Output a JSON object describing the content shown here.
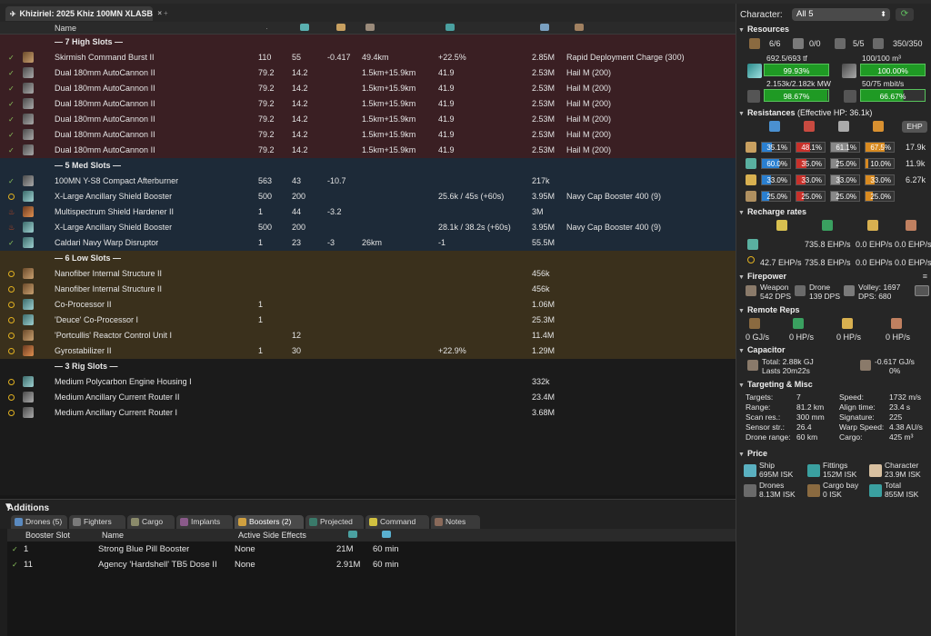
{
  "tab": {
    "title": "Khiziriel: 2025 Khiz 100MN XLASB",
    "close": "×",
    "extra": "+"
  },
  "headers": {
    "name": "Name"
  },
  "rows": [
    {
      "type": "sec",
      "cls": "high",
      "name": "— 7 High Slots —"
    },
    {
      "cls": "high",
      "st": "on",
      "ic": "a",
      "name": "Skirmish Command Burst II",
      "c1": "110",
      "c2": "55",
      "c3": "-0.417",
      "c4": "49.4km",
      "c5": "+22.5%",
      "c6": "2.85M",
      "c7": "Rapid Deployment Charge (300)"
    },
    {
      "cls": "high",
      "st": "on",
      "ic": "c2",
      "name": "Dual 180mm AutoCannon II",
      "c1": "79.2",
      "c2": "14.2",
      "c3": "",
      "c4": "1.5km+15.9km",
      "c5": "41.9",
      "c6": "2.53M",
      "c7": "Hail M (200)"
    },
    {
      "cls": "high",
      "st": "on",
      "ic": "c2",
      "name": "Dual 180mm AutoCannon II",
      "c1": "79.2",
      "c2": "14.2",
      "c3": "",
      "c4": "1.5km+15.9km",
      "c5": "41.9",
      "c6": "2.53M",
      "c7": "Hail M (200)"
    },
    {
      "cls": "high",
      "st": "on",
      "ic": "c2",
      "name": "Dual 180mm AutoCannon II",
      "c1": "79.2",
      "c2": "14.2",
      "c3": "",
      "c4": "1.5km+15.9km",
      "c5": "41.9",
      "c6": "2.53M",
      "c7": "Hail M (200)"
    },
    {
      "cls": "high",
      "st": "on",
      "ic": "c2",
      "name": "Dual 180mm AutoCannon II",
      "c1": "79.2",
      "c2": "14.2",
      "c3": "",
      "c4": "1.5km+15.9km",
      "c5": "41.9",
      "c6": "2.53M",
      "c7": "Hail M (200)"
    },
    {
      "cls": "high",
      "st": "on",
      "ic": "c2",
      "name": "Dual 180mm AutoCannon II",
      "c1": "79.2",
      "c2": "14.2",
      "c3": "",
      "c4": "1.5km+15.9km",
      "c5": "41.9",
      "c6": "2.53M",
      "c7": "Hail M (200)"
    },
    {
      "cls": "high",
      "st": "on",
      "ic": "c2",
      "name": "Dual 180mm AutoCannon II",
      "c1": "79.2",
      "c2": "14.2",
      "c3": "",
      "c4": "1.5km+15.9km",
      "c5": "41.9",
      "c6": "2.53M",
      "c7": "Hail M (200)"
    },
    {
      "type": "sec",
      "cls": "med",
      "name": "— 5 Med Slots —"
    },
    {
      "cls": "med",
      "st": "on",
      "ic": "c2",
      "name": "100MN Y-S8 Compact Afterburner",
      "c1": "563",
      "c2": "43",
      "c3": "-10.7",
      "c4": "",
      "c5": "",
      "c6": "217k",
      "c7": ""
    },
    {
      "cls": "med",
      "st": "off",
      "ic": "b",
      "name": "X-Large Ancillary Shield Booster",
      "c1": "500",
      "c2": "200",
      "c3": "",
      "c4": "",
      "c5": "25.6k / 45s (+60s)",
      "c6": "3.95M",
      "c7": "Navy Cap Booster 400 (9)"
    },
    {
      "cls": "med",
      "st": "ovr",
      "ic": "e",
      "name": "Multispectrum Shield Hardener II",
      "c1": "1",
      "c2": "44",
      "c3": "-3.2",
      "c4": "",
      "c5": "",
      "c6": "3M",
      "c7": ""
    },
    {
      "cls": "med",
      "st": "ovr",
      "ic": "b",
      "name": "X-Large Ancillary Shield Booster",
      "c1": "500",
      "c2": "200",
      "c3": "",
      "c4": "",
      "c5": "28.1k / 38.2s (+60s)",
      "c6": "3.95M",
      "c7": "Navy Cap Booster 400 (9)"
    },
    {
      "cls": "med",
      "st": "on",
      "ic": "b",
      "name": "Caldari Navy Warp Disruptor",
      "c1": "1",
      "c2": "23",
      "c3": "-3",
      "c4": "26km",
      "c5": "-1",
      "c6": "55.5M",
      "c7": ""
    },
    {
      "type": "sec",
      "cls": "low",
      "name": "— 6 Low Slots —"
    },
    {
      "cls": "low",
      "st": "off",
      "ic": "a",
      "name": "Nanofiber Internal Structure II",
      "c1": "",
      "c2": "",
      "c3": "",
      "c4": "",
      "c5": "",
      "c6": "456k",
      "c7": ""
    },
    {
      "cls": "low",
      "st": "off",
      "ic": "a",
      "name": "Nanofiber Internal Structure II",
      "c1": "",
      "c2": "",
      "c3": "",
      "c4": "",
      "c5": "",
      "c6": "456k",
      "c7": ""
    },
    {
      "cls": "low",
      "st": "off",
      "ic": "b",
      "name": "Co-Processor II",
      "c1": "1",
      "c2": "",
      "c3": "",
      "c4": "",
      "c5": "",
      "c6": "1.06M",
      "c7": ""
    },
    {
      "cls": "low",
      "st": "off",
      "ic": "b",
      "name": "'Deuce' Co-Processor I",
      "c1": "1",
      "c2": "",
      "c3": "",
      "c4": "",
      "c5": "",
      "c6": "25.3M",
      "c7": ""
    },
    {
      "cls": "low",
      "st": "off",
      "ic": "a",
      "name": "'Portcullis' Reactor Control Unit I",
      "c1": "",
      "c2": "12",
      "c3": "",
      "c4": "",
      "c5": "",
      "c6": "11.4M",
      "c7": ""
    },
    {
      "cls": "low",
      "st": "off",
      "ic": "e",
      "name": "Gyrostabilizer II",
      "c1": "1",
      "c2": "30",
      "c3": "",
      "c4": "",
      "c5": "+22.9%",
      "c6": "1.29M",
      "c7": ""
    },
    {
      "type": "sec",
      "cls": "rig",
      "name": "— 3 Rig Slots —"
    },
    {
      "cls": "rig",
      "st": "off",
      "ic": "b",
      "name": "Medium Polycarbon Engine Housing I",
      "c1": "",
      "c2": "",
      "c3": "",
      "c4": "",
      "c5": "",
      "c6": "332k",
      "c7": ""
    },
    {
      "cls": "rig",
      "st": "off",
      "ic": "c2",
      "name": "Medium Ancillary Current Router II",
      "c1": "",
      "c2": "",
      "c3": "",
      "c4": "",
      "c5": "",
      "c6": "23.4M",
      "c7": ""
    },
    {
      "cls": "rig",
      "st": "off",
      "ic": "c2",
      "name": "Medium Ancillary Current Router I",
      "c1": "",
      "c2": "",
      "c3": "",
      "c4": "",
      "c5": "",
      "c6": "3.68M",
      "c7": ""
    }
  ],
  "additions": {
    "title": "Additions",
    "tabs": [
      "Drones (5)",
      "Fighters",
      "Cargo",
      "Implants",
      "Boosters (2)",
      "Projected",
      "Command",
      "Notes"
    ],
    "selected_tab": "Boosters (2)",
    "headers": {
      "slot": "Booster Slot",
      "name": "Name",
      "effects": "Active Side Effects"
    },
    "rows": [
      {
        "slot": "1",
        "name": "Strong Blue Pill Booster",
        "effects": "None",
        "price": "21M",
        "dur": "60 min"
      },
      {
        "slot": "11",
        "name": "Agency 'Hardshell' TB5 Dose II",
        "effects": "None",
        "price": "2.91M",
        "dur": "60 min"
      }
    ]
  },
  "right": {
    "character_label": "Character:",
    "character_value": "All 5",
    "resources": {
      "title": "Resources",
      "hardpoints": [
        "6/6",
        "0/0",
        "5/5",
        "350/350"
      ],
      "cpu_text": "692.5/693 tf",
      "cpu_pct": "99.93%",
      "cpu_frac": 0.9993,
      "drone_bay": "100/100 m³",
      "drone_pct": "100.00%",
      "drone_frac": 1.0,
      "pg_text": "2.153k/2.182k MW",
      "pg_pct": "98.67%",
      "pg_frac": 0.9867,
      "bw_text": "50/75 mbit/s",
      "bw_pct": "66.67%",
      "bw_frac": 0.6667
    },
    "resistances": {
      "title": "Resistances",
      "ehp_text": "(Effective HP: 36.1k)",
      "ehp_button": "EHP",
      "rows": [
        {
          "vals": [
            "35.1%",
            "48.1%",
            "61.1%",
            "67.5%"
          ],
          "fr": [
            0.351,
            0.481,
            0.611,
            0.675
          ],
          "hp": "17.9k"
        },
        {
          "vals": [
            "60.0%",
            "35.0%",
            "25.0%",
            "10.0%"
          ],
          "fr": [
            0.6,
            0.35,
            0.25,
            0.1
          ],
          "hp": "11.9k"
        },
        {
          "vals": [
            "33.0%",
            "33.0%",
            "33.0%",
            "33.0%"
          ],
          "fr": [
            0.33,
            0.33,
            0.33,
            0.33
          ],
          "hp": "6.27k"
        },
        {
          "vals": [
            "25.0%",
            "25.0%",
            "25.0%",
            "25.0%"
          ],
          "fr": [
            0.25,
            0.25,
            0.25,
            0.25
          ],
          "hp": ""
        }
      ],
      "colors": [
        "#2a7fd0",
        "#c8302a",
        "#888888",
        "#d88a20"
      ]
    },
    "recharge": {
      "title": "Recharge rates",
      "row1": [
        "735.8 EHP/s",
        "0.0 EHP/s",
        "0.0 EHP/s"
      ],
      "row2": [
        "42.7 EHP/s",
        "735.8 EHP/s",
        "0.0 EHP/s",
        "0.0 EHP/s"
      ]
    },
    "firepower": {
      "title": "Firepower",
      "menu": "≡",
      "weapon_label": "Weapon",
      "weapon_val": "542 DPS",
      "drone_label": "Drone",
      "drone_val": "139 DPS",
      "volley": "Volley: 1697",
      "dps": "DPS: 680"
    },
    "remote": {
      "title": "Remote Reps",
      "vals": [
        "0 GJ/s",
        "0 HP/s",
        "0 HP/s",
        "0 HP/s"
      ]
    },
    "capacitor": {
      "title": "Capacitor",
      "total": "Total: 2.88k GJ",
      "lasts": "Lasts 20m22s",
      "delta": "-0.617 GJ/s",
      "pct": "0%"
    },
    "targeting": {
      "title": "Targeting & Misc",
      "left": [
        [
          "Targets:",
          "7"
        ],
        [
          "Range:",
          "81.2 km"
        ],
        [
          "Scan res.:",
          "300 mm"
        ],
        [
          "Sensor str.:",
          "26.4"
        ],
        [
          "Drone range:",
          "60 km"
        ]
      ],
      "right": [
        [
          "Speed:",
          "1732 m/s"
        ],
        [
          "Align time:",
          "23.4 s"
        ],
        [
          "Signature:",
          "225"
        ],
        [
          "Warp Speed:",
          "4.38 AU/s"
        ],
        [
          "Cargo:",
          "425 m³"
        ]
      ]
    },
    "price": {
      "title": "Price",
      "items": [
        [
          "Ship",
          "695M ISK"
        ],
        [
          "Fittings",
          "152M ISK"
        ],
        [
          "Character",
          "23.9M ISK"
        ],
        [
          "Drones",
          "8.13M ISK"
        ],
        [
          "Cargo bay",
          "0 ISK"
        ],
        [
          "Total",
          "855M ISK"
        ]
      ]
    }
  }
}
